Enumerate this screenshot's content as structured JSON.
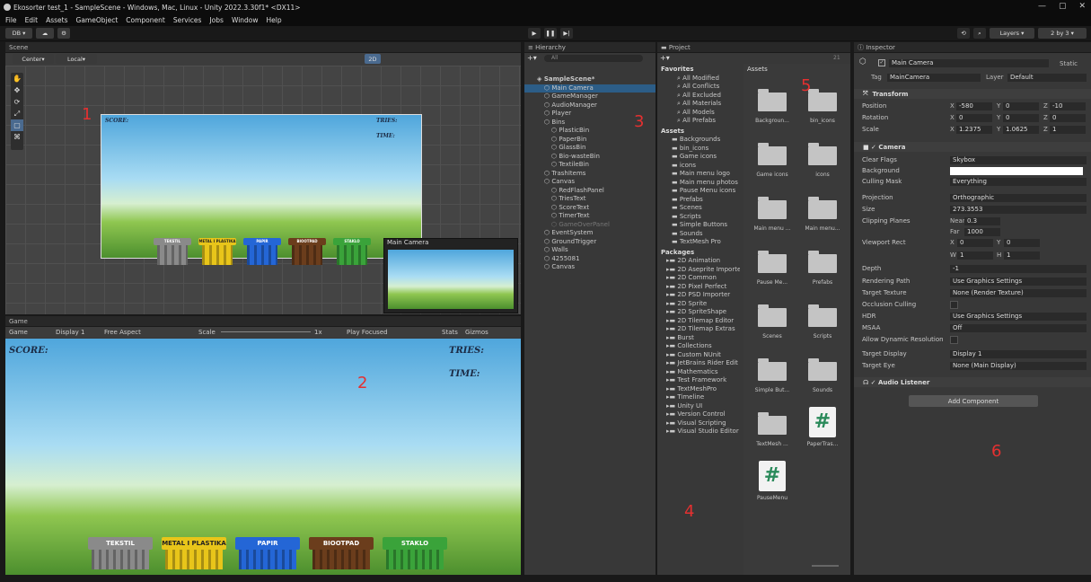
{
  "window": {
    "title": "Ekosorter test_1 - SampleScene - Windows, Mac, Linux - Unity 2022.3.30f1* <DX11>"
  },
  "menu": [
    "File",
    "Edit",
    "Assets",
    "GameObject",
    "Component",
    "Services",
    "Jobs",
    "Window",
    "Help"
  ],
  "toolbar": {
    "account": "DB",
    "layers": "Layers",
    "layout": "2 by 3"
  },
  "scene": {
    "tab": "Scene",
    "center": "Center",
    "local": "Local",
    "btn2d": "2D"
  },
  "game": {
    "tab": "Game",
    "mode": "Game",
    "display": "Display 1",
    "aspect": "Free Aspect",
    "scale": "Scale",
    "scale_val": "1x",
    "play_focused": "Play Focused",
    "stats": "Stats",
    "gizmos": "Gizmos"
  },
  "hud": {
    "score": "SCORE:",
    "tries": "TRIES:",
    "time": "TIME:"
  },
  "bins": [
    {
      "label": "TEKSTIL",
      "color": "#8a8a8a"
    },
    {
      "label": "METAL I PLASTIKA",
      "color": "#e8c51a"
    },
    {
      "label": "PAPIR",
      "color": "#2466d6"
    },
    {
      "label": "BIOOTPAD",
      "color": "#6b3d1c"
    },
    {
      "label": "STAKLO",
      "color": "#3aa33a"
    }
  ],
  "camera_preview": {
    "title": "Main Camera"
  },
  "hierarchy": {
    "tab": "Hierarchy",
    "search": "All",
    "items": [
      {
        "label": "SampleScene*",
        "indent": 0,
        "bold": true
      },
      {
        "label": "Main Camera",
        "indent": 1,
        "selected": true
      },
      {
        "label": "GameManager",
        "indent": 1
      },
      {
        "label": "AudioManager",
        "indent": 1
      },
      {
        "label": "Player",
        "indent": 1
      },
      {
        "label": "Bins",
        "indent": 1
      },
      {
        "label": "PlasticBin",
        "indent": 2
      },
      {
        "label": "PaperBin",
        "indent": 2
      },
      {
        "label": "GlassBin",
        "indent": 2
      },
      {
        "label": "Bio-wasteBin",
        "indent": 2
      },
      {
        "label": "TextileBin",
        "indent": 2
      },
      {
        "label": "TrashItems",
        "indent": 1
      },
      {
        "label": "Canvas",
        "indent": 1
      },
      {
        "label": "RedFlashPanel",
        "indent": 2
      },
      {
        "label": "TriesText",
        "indent": 2
      },
      {
        "label": "ScoreText",
        "indent": 2
      },
      {
        "label": "TimerText",
        "indent": 2
      },
      {
        "label": "GameOverPanel",
        "indent": 2,
        "dim": true
      },
      {
        "label": "EventSystem",
        "indent": 1
      },
      {
        "label": "GroundTrigger",
        "indent": 1
      },
      {
        "label": "Walls",
        "indent": 1
      },
      {
        "label": "4255081",
        "indent": 1
      },
      {
        "label": "Canvas",
        "indent": 1
      }
    ]
  },
  "project": {
    "tab": "Project",
    "favorites_title": "Favorites",
    "favorites": [
      "All Modified",
      "All Conflicts",
      "All Excluded",
      "All Materials",
      "All Models",
      "All Prefabs"
    ],
    "assets_title": "Assets",
    "assets": [
      "Backgrounds",
      "bin_icons",
      "Game icons",
      "icons",
      "Main menu logo",
      "Main menu photos",
      "Pause Menu icons",
      "Prefabs",
      "Scenes",
      "Scripts",
      "Simple Buttons",
      "Sounds",
      "TextMesh Pro"
    ],
    "packages_title": "Packages",
    "packages": [
      "2D Animation",
      "2D Aseprite Importe",
      "2D Common",
      "2D Pixel Perfect",
      "2D PSD Importer",
      "2D Sprite",
      "2D SpriteShape",
      "2D Tilemap Editor",
      "2D Tilemap Extras",
      "Burst",
      "Collections",
      "Custom NUnit",
      "JetBrains Rider Edit",
      "Mathematics",
      "Test Framework",
      "TextMeshPro",
      "Timeline",
      "Unity UI",
      "Version Control",
      "Visual Scripting",
      "Visual Studio Editor"
    ],
    "grid_title": "Assets",
    "grid": [
      {
        "label": "Backgroun...",
        "kind": "folder"
      },
      {
        "label": "bin_icons",
        "kind": "folder"
      },
      {
        "label": "Game icons",
        "kind": "folder"
      },
      {
        "label": "icons",
        "kind": "folder"
      },
      {
        "label": "Main menu ...",
        "kind": "folder"
      },
      {
        "label": "Main menu...",
        "kind": "folder"
      },
      {
        "label": "Pause Me...",
        "kind": "folder"
      },
      {
        "label": "Prefabs",
        "kind": "folder"
      },
      {
        "label": "Scenes",
        "kind": "folder"
      },
      {
        "label": "Scripts",
        "kind": "folder"
      },
      {
        "label": "Simple But...",
        "kind": "folder"
      },
      {
        "label": "Sounds",
        "kind": "folder"
      },
      {
        "label": "TextMesh ...",
        "kind": "folder"
      },
      {
        "label": "PaperTras...",
        "kind": "script"
      },
      {
        "label": "PauseMenu",
        "kind": "script"
      }
    ],
    "count": "21"
  },
  "inspector": {
    "tab": "Inspector",
    "object_name": "Main Camera",
    "static": "Static",
    "tag_label": "Tag",
    "tag": "MainCamera",
    "layer_label": "Layer",
    "layer": "Default",
    "transform": {
      "title": "Transform",
      "position": {
        "label": "Position",
        "x": "-580",
        "y": "0",
        "z": "-10"
      },
      "rotation": {
        "label": "Rotation",
        "x": "0",
        "y": "0",
        "z": "0"
      },
      "scale": {
        "label": "Scale",
        "x": "1.2375",
        "y": "1.0625",
        "z": "1"
      }
    },
    "camera": {
      "title": "Camera",
      "rows": [
        {
          "label": "Clear Flags",
          "value": "Skybox"
        },
        {
          "label": "Background",
          "value": ""
        },
        {
          "label": "Culling Mask",
          "value": "Everything"
        },
        {
          "label": "Projection",
          "value": "Orthographic"
        },
        {
          "label": "Size",
          "value": "273.3553"
        },
        {
          "label": "Clipping Planes",
          "value": ""
        },
        {
          "label": "Viewport Rect",
          "value": ""
        },
        {
          "label": "Depth",
          "value": "-1"
        },
        {
          "label": "Rendering Path",
          "value": "Use Graphics Settings"
        },
        {
          "label": "Target Texture",
          "value": "None (Render Texture)"
        },
        {
          "label": "Occlusion Culling",
          "value": ""
        },
        {
          "label": "HDR",
          "value": "Use Graphics Settings"
        },
        {
          "label": "MSAA",
          "value": "Off"
        },
        {
          "label": "Allow Dynamic Resolution",
          "value": ""
        },
        {
          "label": "Target Display",
          "value": "Display 1"
        },
        {
          "label": "Target Eye",
          "value": "None (Main Display)"
        }
      ],
      "near_label": "Near",
      "near": "0.3",
      "far_label": "Far",
      "far": "1000",
      "vp": {
        "x": "0",
        "y": "0",
        "w": "1",
        "h": "1"
      }
    },
    "audio_title": "Audio Listener",
    "add_component": "Add Component"
  },
  "annotations": [
    "1",
    "2",
    "3",
    "4",
    "5",
    "6"
  ],
  "colors": {
    "selection": "#2c5d87",
    "panel": "#383838",
    "annotation": "#e53030"
  }
}
